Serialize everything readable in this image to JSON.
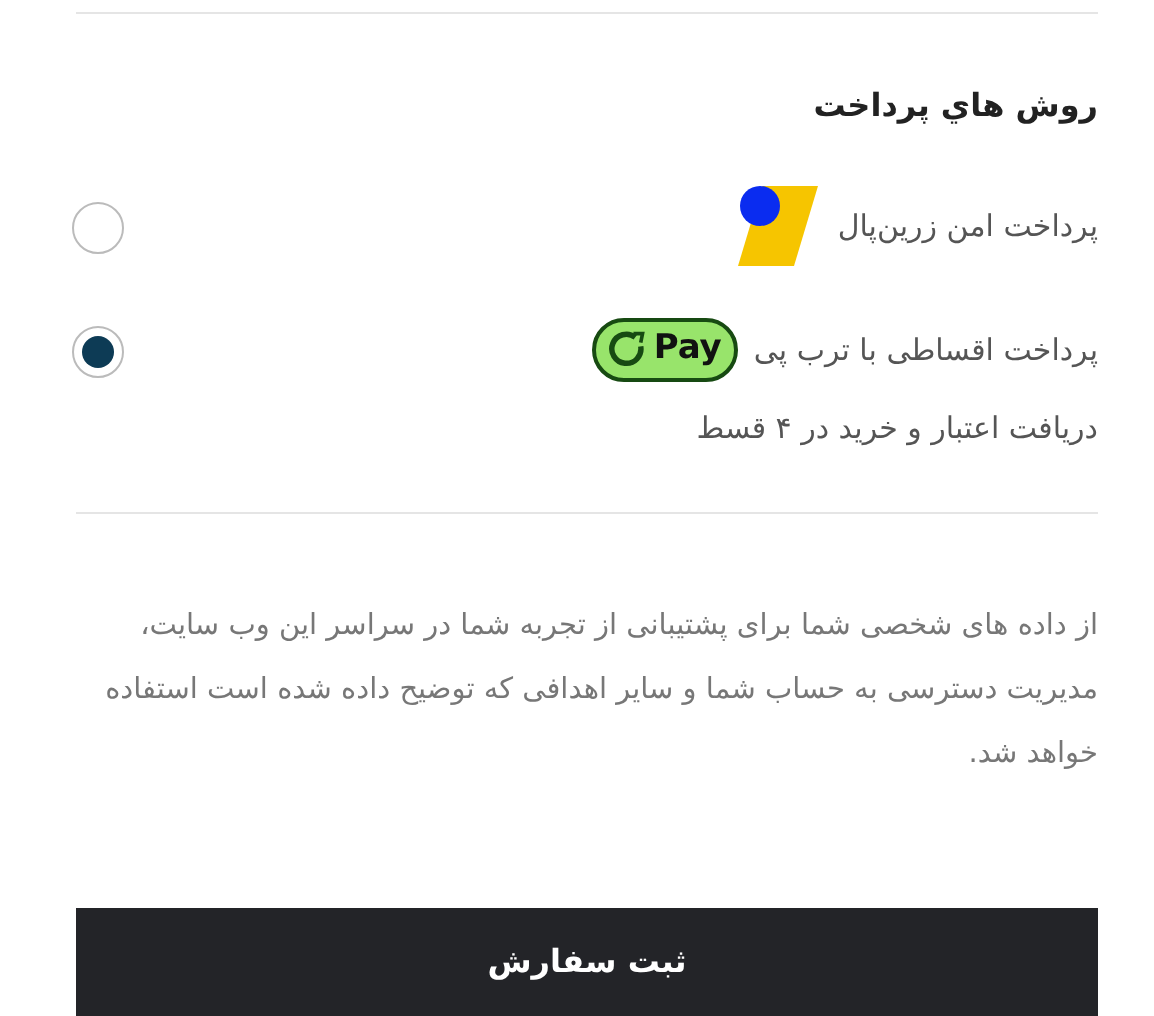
{
  "heading": "روش هاي پرداخت",
  "payment_methods": [
    {
      "kind": "zarinpal",
      "label": "پرداخت امن زرین‌پال",
      "selected": false
    },
    {
      "kind": "torob",
      "label": "پرداخت اقساطی با ترب پی",
      "badge": "Pay",
      "description": "دریافت اعتبار و خرید در ۴ قسط",
      "selected": true
    }
  ],
  "privacy_note": "از داده های شخصی شما برای پشتیبانی از تجربه شما در سراسر این وب سایت، مدیریت دسترسی به حساب شما و سایر اهدافی که توضیح داده شده است استفاده خواهد شد.",
  "submit_button": "ثبت سفارش"
}
